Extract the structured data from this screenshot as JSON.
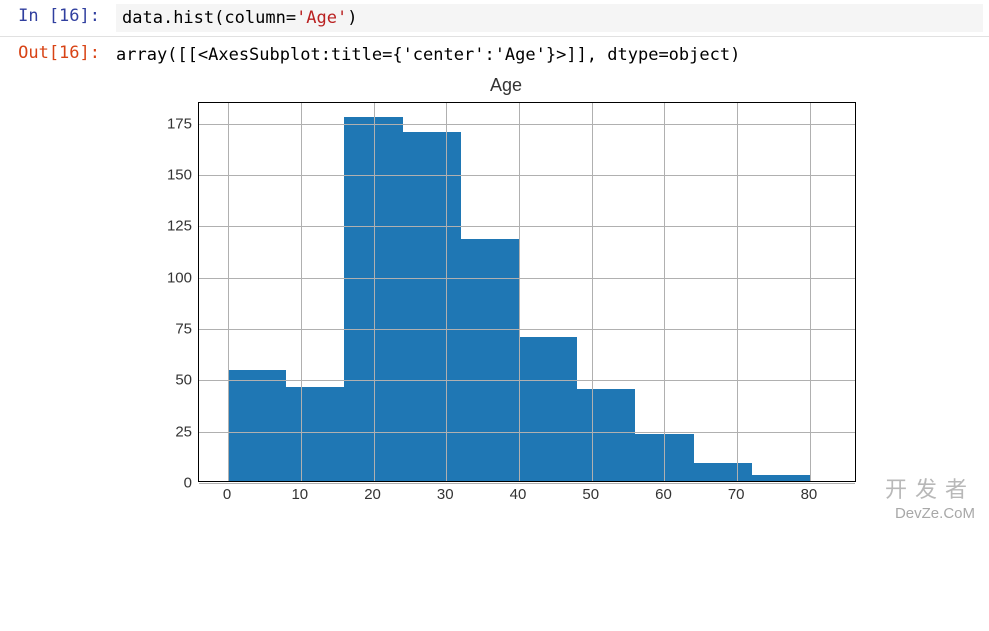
{
  "input": {
    "prompt": "In  [16]:",
    "code_prefix": "data.",
    "code_fn": "hist",
    "code_open": "(",
    "code_kw": "column",
    "code_eq": "=",
    "code_str": "'Age'",
    "code_close": ")"
  },
  "output": {
    "prompt": "Out[16]:",
    "text": "array([[<AxesSubplot:title={'center':'Age'}>]], dtype=object)"
  },
  "chart_data": {
    "type": "bar",
    "title": "Age",
    "xlabel": "",
    "ylabel": "",
    "x_ticks": [
      0,
      10,
      20,
      30,
      40,
      50,
      60,
      70,
      80
    ],
    "y_ticks": [
      0,
      25,
      50,
      75,
      100,
      125,
      150,
      175
    ],
    "ylim": [
      0,
      185
    ],
    "xlim": [
      -4,
      84
    ],
    "bin_edges": [
      0,
      8,
      16,
      24,
      32,
      40,
      48,
      56,
      64,
      72,
      80
    ],
    "values": [
      54,
      46,
      177,
      170,
      118,
      70,
      45,
      23,
      9,
      3
    ]
  },
  "watermark": {
    "main": "开发者",
    "sub": "DevZe.CoM"
  }
}
